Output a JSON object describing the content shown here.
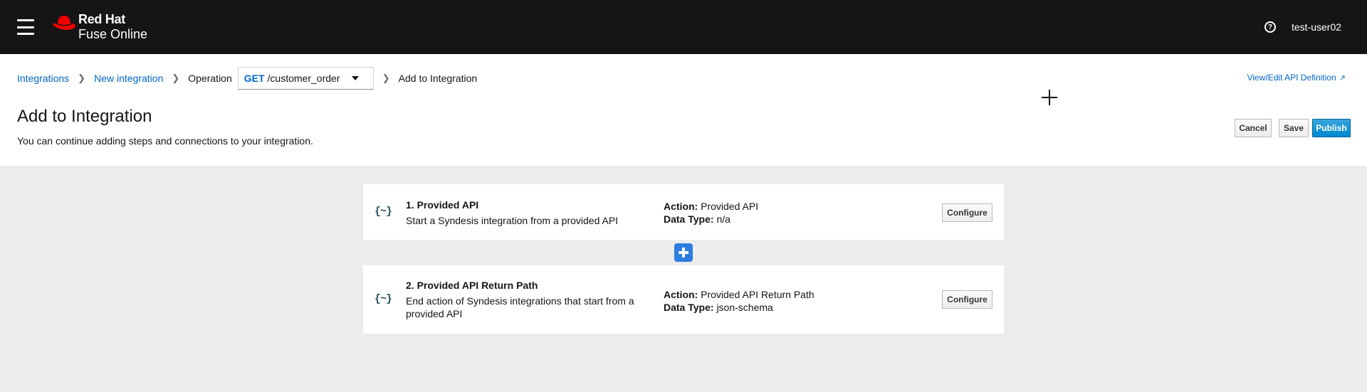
{
  "masthead": {
    "brand_line1": "Red Hat",
    "brand_line2": "Fuse Online",
    "help_icon": "question-circle-icon",
    "user": "test-user02"
  },
  "breadcrumb": {
    "items": [
      "Integrations",
      "New integration",
      "Operation"
    ],
    "operation_method": "GET",
    "operation_path": "/customer_order",
    "current": "Add to Integration"
  },
  "header": {
    "view_edit_link": "View/Edit API Definition",
    "title": "Add to Integration",
    "description": "You can continue adding steps and connections to your integration.",
    "cancel_label": "Cancel",
    "save_label": "Save",
    "publish_label": "Publish"
  },
  "steps": [
    {
      "icon_text": "{~}",
      "title": "1. Provided API",
      "description": "Start a Syndesis integration from a provided API",
      "action_label": "Action:",
      "action_value": "Provided API",
      "data_type_label": "Data Type:",
      "data_type_value": "n/a",
      "configure_label": "Configure"
    },
    {
      "icon_text": "{~}",
      "title": "2. Provided API Return Path",
      "description": "End action of Syndesis integrations that start from a provided API",
      "action_label": "Action:",
      "action_value": "Provided API Return Path",
      "data_type_label": "Data Type:",
      "data_type_value": "json-schema",
      "configure_label": "Configure"
    }
  ],
  "colors": {
    "masthead_bg": "#151515",
    "link": "#06c",
    "primary": "#0088ce",
    "add_step": "#2c7de0",
    "canvas_bg": "#ececec"
  }
}
